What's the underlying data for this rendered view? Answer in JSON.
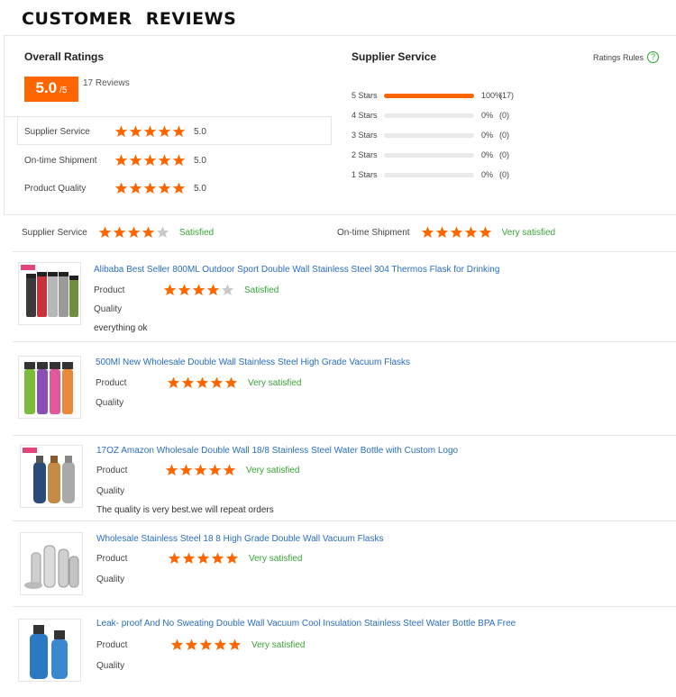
{
  "page": {
    "title": "CUSTOMER REVIEWS"
  },
  "overall": {
    "title": "Overall Ratings",
    "score": "5.0",
    "score_suffix": "/5",
    "review_count": "17 Reviews",
    "metrics": [
      {
        "label": "Supplier Service",
        "stars": 5,
        "value": "5.0"
      },
      {
        "label": "On-time Shipment",
        "stars": 5,
        "value": "5.0"
      },
      {
        "label": "Product Quality",
        "stars": 5,
        "value": "5.0"
      }
    ]
  },
  "supplier_service": {
    "title": "Supplier Service",
    "rules_label": "Ratings Rules",
    "distribution": [
      {
        "label": "5 Stars",
        "fraction": 1.0,
        "percent": "100%",
        "count": "(17)"
      },
      {
        "label": "4 Stars",
        "fraction": 0.0,
        "percent": "0%",
        "count": "(0)"
      },
      {
        "label": "3 Stars",
        "fraction": 0.0,
        "percent": "0%",
        "count": "(0)"
      },
      {
        "label": "2 Stars",
        "fraction": 0.0,
        "percent": "0%",
        "count": "(0)"
      },
      {
        "label": "1 Stars",
        "fraction": 0.0,
        "percent": "0%",
        "count": "(0)"
      }
    ]
  },
  "strip": {
    "supplier": {
      "label": "Supplier Service",
      "stars": 4,
      "status": "Satisfied"
    },
    "shipment": {
      "label": "On-time Shipment",
      "stars": 5,
      "status": "Very satisfied"
    }
  },
  "reviews": [
    {
      "product": "Alibaba Best Seller 800ML Outdoor Sport Double Wall Stainless Steel 304 Thermos Flask for Drinking",
      "label_product": "Product",
      "label_quality": "Quality",
      "stars": 4,
      "status": "Satisfied",
      "comment": "everything ok"
    },
    {
      "product": "500Ml New Wholesale Double Wall Stainless Steel High Grade Vacuum Flasks",
      "label_product": "Product",
      "label_quality": "Quality",
      "stars": 5,
      "status": "Very satisfied",
      "comment": ""
    },
    {
      "product": "17OZ Amazon Wholesale Double Wall 18/8 Stainless Steel Water Bottle with Custom Logo",
      "label_product": "Product",
      "label_quality": "Quality",
      "stars": 5,
      "status": "Very satisfied",
      "comment": "The quality is very best.we will repeat orders"
    },
    {
      "product": "Wholesale Stainless Steel 18 8 High Grade Double Wall Vacuum Flasks",
      "label_product": "Product",
      "label_quality": "Quality",
      "stars": 5,
      "status": "Very satisfied",
      "comment": ""
    },
    {
      "product": "Leak- proof And No Sweating Double Wall Vacuum Cool Insulation Stainless Steel Water Bottle BPA Free",
      "label_product": "Product",
      "label_quality": "Quality",
      "stars": 5,
      "status": "Very satisfied",
      "comment": ""
    }
  ],
  "colors": {
    "accent": "#ff6600",
    "star_empty": "#c8c8c8",
    "link": "#2a6dc0",
    "status": "#3aa33a"
  }
}
